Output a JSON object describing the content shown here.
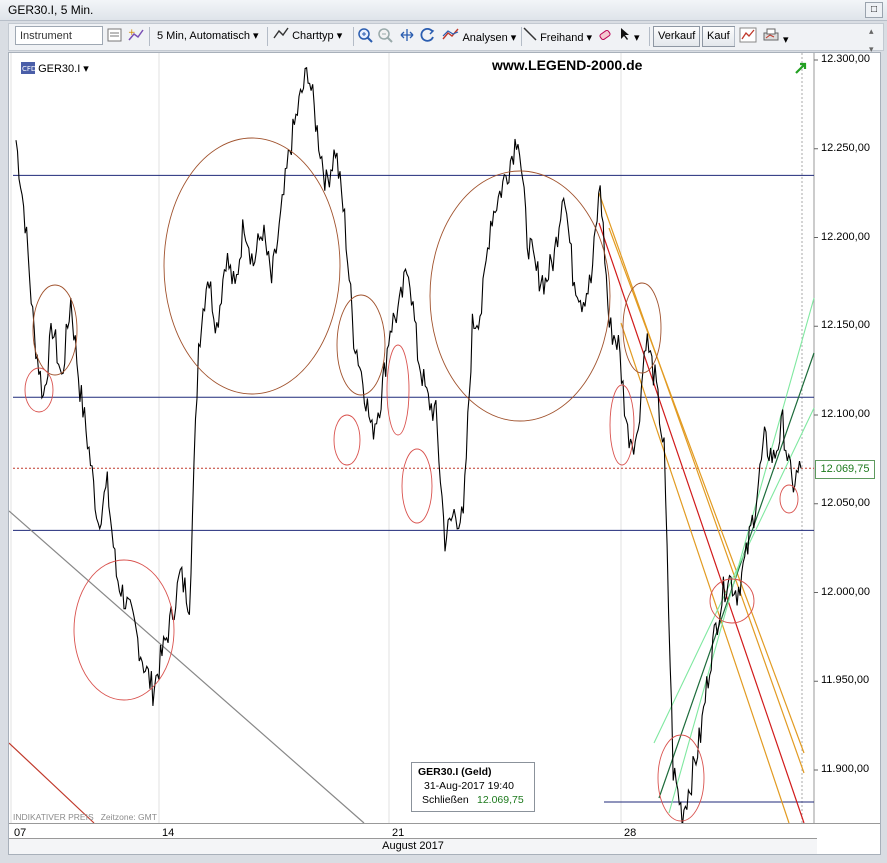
{
  "window": {
    "title": "GER30.I, 5 Min."
  },
  "toolbar": {
    "instrument_placeholder": "Instrument",
    "interval_label": "5 Min, Automatisch",
    "charttype_label": "Charttyp",
    "analyses_label": "Analysen",
    "freehand_label": "Freihand",
    "sell_label": "Verkauf",
    "buy_label": "Kauf"
  },
  "chart": {
    "instrument_label": "GER30.I",
    "watermark": "www.LEGEND-2000.de",
    "indicator_text": "INDIKATIVER PREIS",
    "timezone_text": "Zeitzone: GMT",
    "month_label": "August 2017",
    "current_price": "12.069,75",
    "tooltip": {
      "title": "GER30.I (Geld)",
      "datetime": "31-Aug-2017 19:40",
      "close_label": "Schließen",
      "close_value": "12.069,75"
    }
  },
  "chart_data": {
    "type": "line",
    "title": "GER30.I, 5 Min.",
    "x_ticks": [
      "07",
      "14",
      "21",
      "28"
    ],
    "y_ticks": [
      "12.300,00",
      "12.250,00",
      "12.200,00",
      "12.150,00",
      "12.100,00",
      "12.050,00",
      "12.000,00",
      "11.950,00",
      "11.900,00"
    ],
    "ylim": [
      11860,
      12300
    ],
    "grid": false,
    "series": [
      {
        "values": [
          12255,
          12210,
          12145,
          12110,
          12150,
          12120,
          12165,
          12115,
          12080,
          12040,
          12060,
          12010,
          11995,
          11980,
          11960,
          11945,
          11965,
          11985,
          12010,
          11995,
          12140,
          12180,
          12150,
          12190,
          12170,
          12210,
          12185,
          12205,
          12175,
          12210,
          12250,
          12275,
          12295,
          12260,
          12230,
          12250,
          12210,
          12145,
          12120,
          12090,
          12110,
          12150,
          12160,
          12185,
          12135,
          12110,
          12100,
          12030,
          12045,
          12040,
          12150,
          12160,
          12210,
          12225,
          12240,
          12260,
          12200,
          12180,
          12175,
          12190,
          12230,
          12180,
          12165,
          12175,
          12230,
          12150,
          12140,
          12090,
          12085,
          12145,
          12120,
          12080,
          11900,
          11875,
          11895,
          11920,
          11960,
          11990,
          12010,
          12000,
          12020,
          12050,
          12085,
          12075,
          12095,
          12060,
          12070
        ]
      }
    ],
    "levels": [
      12235,
      12110,
      12035,
      12070,
      11882
    ]
  },
  "colors": {
    "price_line": "#000000",
    "level_line": "#1f2a7a",
    "circle_brown": "#a0522d",
    "circle_pink": "#d9534f",
    "channel_green": "#7fe8a0",
    "trend_dark_green": "#1c6b3a",
    "channel_orange": "#e29b22",
    "channel_red": "#d11b1b",
    "current_price_text": "#1d7a1d"
  }
}
